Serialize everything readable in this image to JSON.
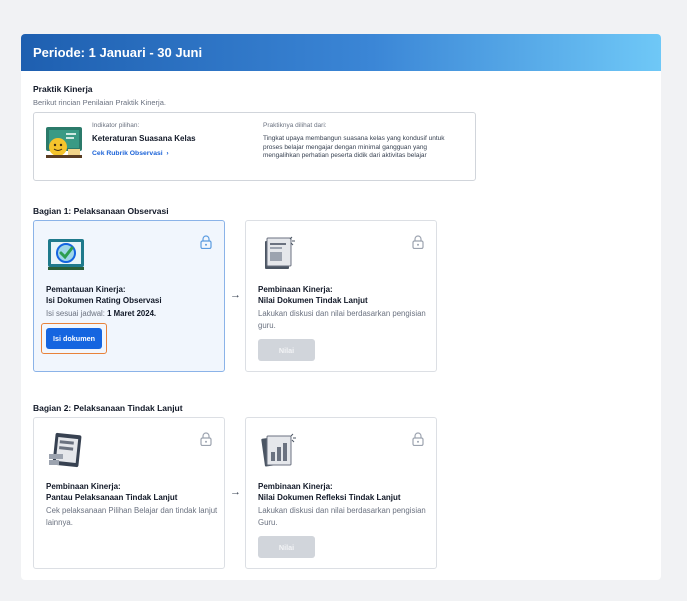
{
  "header": {
    "title": "Periode: 1 Januari - 30 Juni"
  },
  "practice": {
    "title": "Praktik Kinerja",
    "subtitle": "Berikut rincian Penilaian Praktik Kinerja.",
    "indicator_label": "Indikator pilihan:",
    "indicator_value": "Keteraturan Suasana Kelas",
    "rubric_link": "Cek Rubrik Observasi",
    "seen_label": "Praktiknya dilihat dari:",
    "seen_desc": "Tingkat upaya membangun suasana kelas yang kondusif untuk proses belajar mengajar dengan minimal gangguan yang mengalihkan perhatian peserta didik dari aktivitas belajar",
    "icon": "classroom-illustration-icon"
  },
  "part1": {
    "title": "Bagian 1: Pelaksanaan Observasi",
    "card1": {
      "title_line1": "Pemantauan Kinerja:",
      "title_line2": "Isi Dokumen Rating Observasi",
      "desc_prefix": "Isi sesuai jadwal: ",
      "desc_date": "1 Maret 2024.",
      "button": "Isi dokumen",
      "icon": "observation-checklist-icon"
    },
    "card2": {
      "title_line1": "Pembinaan Kinerja:",
      "title_line2": "Nilai Dokumen Tindak Lanjut",
      "desc": "Lakukan diskusi dan nilai berdasarkan pengisian guru.",
      "button": "Nilai",
      "icon": "document-review-icon"
    }
  },
  "part2": {
    "title": "Bagian 2: Pelaksanaan Tindak Lanjut",
    "card1": {
      "title_line1": "Pembinaan Kinerja:",
      "title_line2": "Pantau Pelaksanaan Tindak Lanjut",
      "desc": "Cek pelaksanaan Pilihan Belajar dan tindak lanjut lainnya.",
      "icon": "tablet-monitoring-icon"
    },
    "card2": {
      "title_line1": "Pembinaan Kinerja:",
      "title_line2": "Nilai Dokumen Refleksi Tindak Lanjut",
      "desc": "Lakukan diskusi dan nilai berdasarkan pengisian Guru.",
      "button": "Nilai",
      "icon": "chart-document-icon"
    }
  },
  "arrow": "→",
  "colors": {
    "primary": "#1565e0",
    "highlight": "#e8823a",
    "header_start": "#1e5fb0",
    "header_end": "#6fc8f7"
  }
}
